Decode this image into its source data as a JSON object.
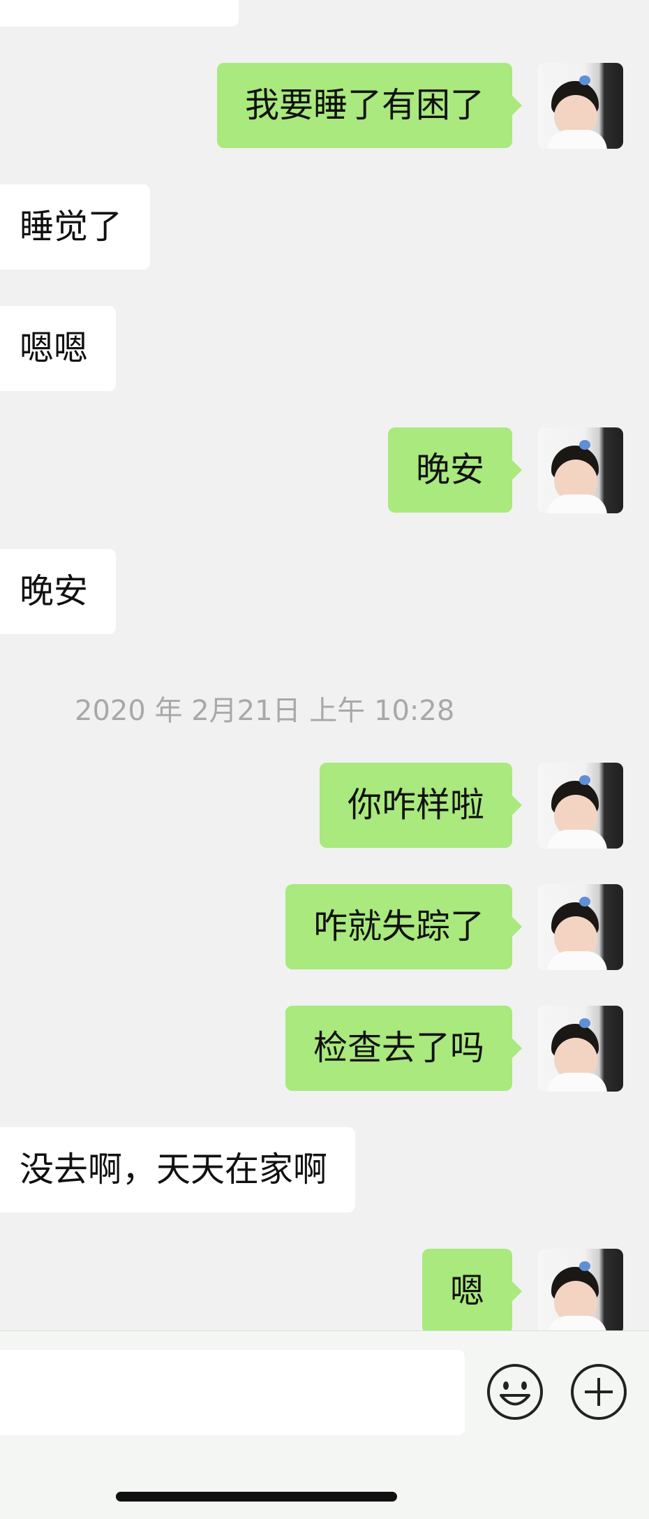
{
  "conversation": {
    "messages": [
      {
        "direction": "out",
        "text": "我要睡了有困了"
      },
      {
        "direction": "in",
        "text": "睡觉了"
      },
      {
        "direction": "in",
        "text": "嗯嗯"
      },
      {
        "direction": "out",
        "text": "晚安"
      },
      {
        "direction": "in",
        "text": "晚安"
      },
      {
        "direction": "out",
        "text": "你咋样啦"
      },
      {
        "direction": "out",
        "text": "咋就失踪了"
      },
      {
        "direction": "out",
        "text": "检查去了吗"
      },
      {
        "direction": "in",
        "text": "没去啊，天天在家啊"
      },
      {
        "direction": "out",
        "text": "嗯"
      }
    ],
    "timestamp": "2020 年 2月21日 上午 10:28"
  },
  "input": {
    "value": ""
  },
  "colors": {
    "outgoing_bubble": "#a9e97d",
    "incoming_bubble": "#ffffff",
    "background": "#f1f1f1"
  },
  "icons": {
    "emoji": "smiley-face-icon",
    "more": "plus-circle-icon"
  }
}
